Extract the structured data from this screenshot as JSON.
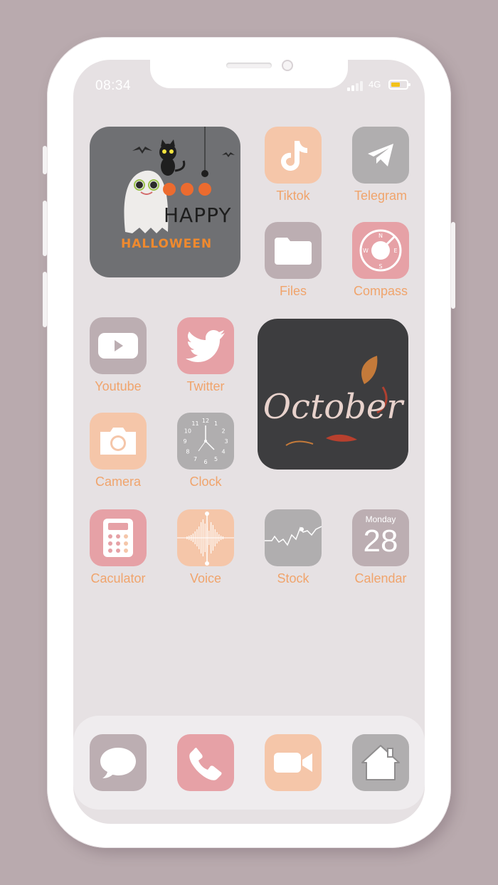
{
  "status": {
    "time": "08:34",
    "network": "4G",
    "battery_color": "#f2c21b"
  },
  "colors": {
    "background": "#b9aaae",
    "screen": "#e6e1e3",
    "label": "#f0a46c",
    "peach": "#f5c6a9",
    "gray": "#b0aeaf",
    "mauve": "#bcaeb2",
    "pink": "#e6a1a6"
  },
  "widgets": {
    "halloween": {
      "line1": "HAPPY",
      "line2": "HALLOWEEN",
      "bg": "#6f7073"
    },
    "october": {
      "text": "October",
      "bg": "#3d3d3f"
    }
  },
  "apps": {
    "tiktok": {
      "label": "Tiktok",
      "icon": "tiktok-icon"
    },
    "telegram": {
      "label": "Telegram",
      "icon": "paper-plane-icon"
    },
    "files": {
      "label": "Files",
      "icon": "folder-icon"
    },
    "compass": {
      "label": "Compass",
      "icon": "compass-icon",
      "letters": [
        "N",
        "E",
        "S",
        "W"
      ]
    },
    "youtube": {
      "label": "Youtube",
      "icon": "play-icon"
    },
    "twitter": {
      "label": "Twitter",
      "icon": "bird-icon"
    },
    "camera": {
      "label": "Camera",
      "icon": "camera-icon"
    },
    "clock": {
      "label": "Clock",
      "icon": "clock-icon",
      "numbers": [
        "12",
        "1",
        "2",
        "3",
        "4",
        "5",
        "6",
        "7",
        "8",
        "9",
        "10",
        "11"
      ]
    },
    "calculator": {
      "label": "Caculator",
      "icon": "calculator-icon"
    },
    "voice": {
      "label": "Voice",
      "icon": "waveform-icon"
    },
    "stock": {
      "label": "Stock",
      "icon": "stock-chart-icon"
    },
    "calendar": {
      "label": "Calendar",
      "icon": "calendar-icon",
      "weekday": "Monday",
      "day": "28"
    }
  },
  "dock": [
    {
      "icon": "message-icon"
    },
    {
      "icon": "phone-icon"
    },
    {
      "icon": "video-icon"
    },
    {
      "icon": "home-icon"
    }
  ]
}
